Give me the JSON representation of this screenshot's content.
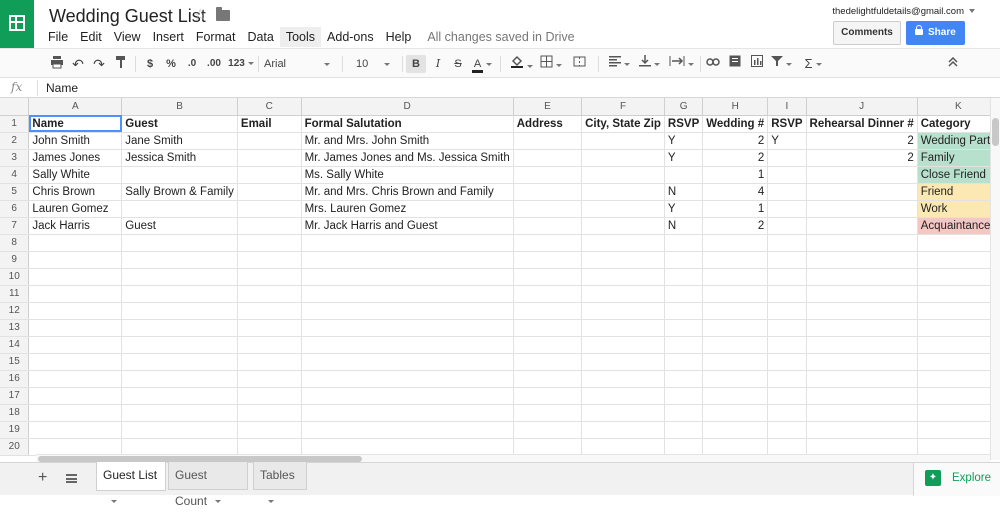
{
  "header": {
    "title": "Wedding Guest List",
    "account": "thedelightfuldetails@gmail.com",
    "comments_label": "Comments",
    "share_label": "Share"
  },
  "menu": [
    "File",
    "Edit",
    "View",
    "Insert",
    "Format",
    "Data",
    "Tools",
    "Add-ons",
    "Help"
  ],
  "menu_active": "Tools",
  "saved_status": "All changes saved in Drive",
  "toolbar": {
    "currency": "$",
    "percent": "%",
    "dec_less": ".0",
    "dec_more": ".00",
    "number_format": "123",
    "font": "Arial",
    "font_size": "10",
    "bold": "B",
    "italic": "I",
    "strike": "S",
    "text_color": "A",
    "functions": "Σ"
  },
  "formula_bar": {
    "fx": "fx",
    "content": "Name"
  },
  "columns": [
    "A",
    "B",
    "C",
    "D",
    "E",
    "F",
    "G",
    "H",
    "I",
    "J",
    "K"
  ],
  "rows": [
    [
      "Name",
      "Guest",
      "Email",
      "Formal Salutation",
      "Address",
      "City, State Zip",
      "RSVP",
      "Wedding #",
      "RSVP",
      "Rehearsal Dinner #",
      "Category"
    ],
    [
      "John Smith",
      "Jane Smith",
      "",
      "Mr. and Mrs. John Smith",
      "",
      "",
      "Y",
      "2",
      "Y",
      "2",
      "Wedding Party"
    ],
    [
      "James Jones",
      "Jessica Smith",
      "",
      "Mr. James Jones and Ms. Jessica Smith",
      "",
      "",
      "Y",
      "2",
      "",
      "2",
      "Family"
    ],
    [
      "Sally White",
      "",
      "",
      "Ms. Sally White",
      "",
      "",
      "",
      "1",
      "",
      "",
      "Close Friend"
    ],
    [
      "Chris Brown",
      "Sally Brown & Family",
      "",
      "Mr. and Mrs. Chris Brown and Family",
      "",
      "",
      "N",
      "4",
      "",
      "",
      "Friend"
    ],
    [
      "Lauren Gomez",
      "",
      "",
      "Mrs. Lauren Gomez",
      "",
      "",
      "Y",
      "1",
      "",
      "",
      "Work"
    ],
    [
      "Jack Harris",
      "Guest",
      "",
      "Mr. Jack Harris and Guest",
      "",
      "",
      "N",
      "2",
      "",
      "",
      "Acquaintance"
    ]
  ],
  "row_numbers": [
    "1",
    "2",
    "3",
    "4",
    "5",
    "6",
    "7",
    "8",
    "9",
    "10",
    "11",
    "12",
    "13",
    "14",
    "15",
    "16",
    "17",
    "18",
    "19",
    "20"
  ],
  "category_colors": {
    "Wedding Party": "#b7e1cd",
    "Family": "#b7e1cd",
    "Close Friend": "#b7e1cd",
    "Friend": "#fce8b2",
    "Work": "#fce8b2",
    "Acquaintance": "#f4c7c3"
  },
  "sheet_tabs": [
    {
      "label": "Guest List",
      "active": true
    },
    {
      "label": "Guest Count",
      "active": false
    },
    {
      "label": "Tables",
      "active": false
    }
  ],
  "explore_label": "Explore",
  "colors": {
    "brand_green": "#0f9d58",
    "share_blue": "#4285f4",
    "selection": "#4d90fe"
  }
}
